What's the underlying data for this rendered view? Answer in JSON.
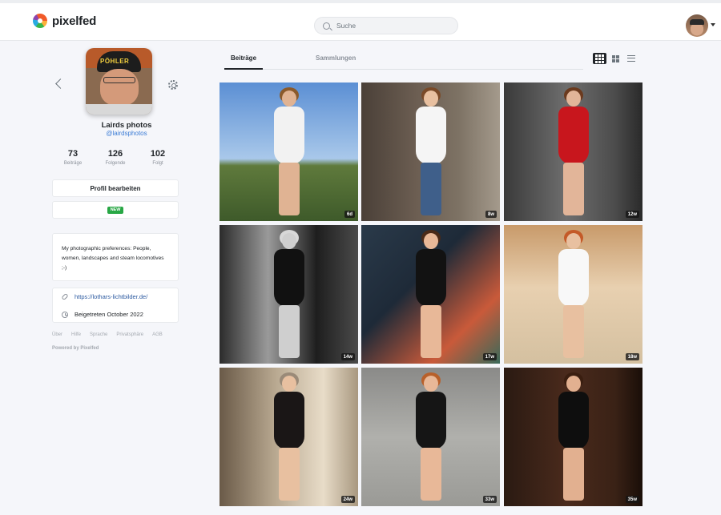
{
  "header": {
    "brand": "pixelfed",
    "search_placeholder": "Suche"
  },
  "profile": {
    "display_name": "Lairds photos",
    "username": "@lairdsphotos",
    "cap_text": "PÖHLER",
    "stats": [
      {
        "value": "73",
        "label": "Beiträge"
      },
      {
        "value": "126",
        "label": "Folgende"
      },
      {
        "value": "102",
        "label": "Folgt"
      }
    ],
    "edit_label": "Profil bearbeiten",
    "new_badge": "NEW",
    "bio": "My photographic preferences: People, women, landscapes and steam locomotives ;-)",
    "website": "https://lothars-lichtbilder.de/",
    "joined": "Beigetreten October 2022"
  },
  "footer": {
    "links": [
      "Über",
      "Hilfe",
      "Sprache",
      "Privatsphäre",
      "AGB"
    ],
    "powered": "Powered by Pixelfed"
  },
  "tabs": [
    {
      "label": "Beiträge",
      "active": true
    },
    {
      "label": "Sammlungen",
      "active": false
    }
  ],
  "posts": [
    {
      "age": "6d",
      "bg": "linear-gradient(#5b8fd4 0%, #a9c8ea 55%, #5f7a3c 60%, #3e5a2a 100%)",
      "dress": "#f2f2f2",
      "skin": "#e0b393",
      "hair": "#8b5a2b"
    },
    {
      "age": "8w",
      "bg": "linear-gradient(90deg, #4a4038 0%, #6c5e52 40%, #7d7264 70%, #a49a8c 100%)",
      "dress": "#f5f5f5",
      "skin": "#e8c0a0",
      "hair": "#7a4a28",
      "legs_color": "#3f5f8a"
    },
    {
      "age": "12w",
      "bg": "linear-gradient(90deg, #3a3a3a 0%, #6e6e6e 45%, #4c4c4c 80%, #2a2a2a 100%)",
      "dress": "#c8161d",
      "skin": "#e2b599",
      "hair": "#6b3a1e"
    },
    {
      "age": "14w",
      "bg": "linear-gradient(90deg, #2c2c2c 0%, #9a9a9a 35%, #1e1e1e 70%, #4a4a4a 100%)",
      "dress": "#111111",
      "skin": "#cfcfcf",
      "hair": "#d8d8d8"
    },
    {
      "age": "17w",
      "bg": "linear-gradient(135deg, #2a3a4a 0%, #1e2a38 40%, #c95a3a 75%, #3a6a5a 100%)",
      "dress": "#121212",
      "skin": "#e8b898",
      "hair": "#4a2a18"
    },
    {
      "age": "18w",
      "bg": "linear-gradient(#c89a6a 0%, #e8d0b0 45%, #d4c0a0 100%)",
      "dress": "#f8f8f8",
      "skin": "#e8c0a0",
      "hair": "#c45a28"
    },
    {
      "age": "24w",
      "bg": "linear-gradient(90deg, #6a5a48 0%, #b8a890 40%, #e8dcc8 75%, #a89880 100%)",
      "dress": "#1a1616",
      "skin": "#e8c0a0",
      "hair": "#9a8a78"
    },
    {
      "age": "33w",
      "bg": "linear-gradient(#8a8a88 0%, #b0b0ac 50%, #9a9a96 100%)",
      "dress": "#151515",
      "skin": "#e8b898",
      "hair": "#b8602a"
    },
    {
      "age": "35w",
      "bg": "linear-gradient(90deg, #2a1a12 0%, #4a2a1c 45%, #3a2216 80%, #1a0e08 100%)",
      "dress": "#0e0e0e",
      "skin": "#e2b090",
      "hair": "#3a1e10"
    }
  ]
}
